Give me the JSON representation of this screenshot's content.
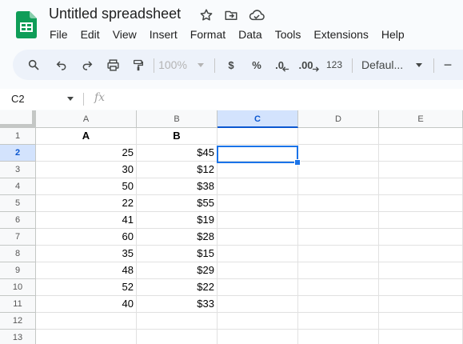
{
  "app": {
    "title": "Untitled spreadsheet",
    "accent": "#0f9d58",
    "menu": [
      "File",
      "Edit",
      "View",
      "Insert",
      "Format",
      "Data",
      "Tools",
      "Extensions",
      "Help"
    ]
  },
  "toolbar": {
    "zoom": "100%",
    "currency": "$",
    "percent": "%",
    "decrease_decimal": ".0",
    "increase_decimal": ".00",
    "more_formats": "123",
    "font": "Defaul...",
    "font_size_minus": "−",
    "icons": [
      "search-icon",
      "undo-icon",
      "redo-icon",
      "print-icon",
      "paint-format-icon"
    ]
  },
  "formula_bar": {
    "cell_ref": "C2",
    "fx": "fx",
    "value": ""
  },
  "grid": {
    "columns": [
      "A",
      "B",
      "C",
      "D",
      "E"
    ],
    "selected_column": "C",
    "selected_row": 2,
    "rows": [
      {
        "n": "1",
        "a": "A",
        "b": "B"
      },
      {
        "n": "2",
        "a": "25",
        "b": "$45"
      },
      {
        "n": "3",
        "a": "30",
        "b": "$12"
      },
      {
        "n": "4",
        "a": "50",
        "b": "$38"
      },
      {
        "n": "5",
        "a": "22",
        "b": "$55"
      },
      {
        "n": "6",
        "a": "41",
        "b": "$19"
      },
      {
        "n": "7",
        "a": "60",
        "b": "$28"
      },
      {
        "n": "8",
        "a": "35",
        "b": "$15"
      },
      {
        "n": "9",
        "a": "48",
        "b": "$29"
      },
      {
        "n": "10",
        "a": "52",
        "b": "$22"
      },
      {
        "n": "11",
        "a": "40",
        "b": "$33"
      },
      {
        "n": "12",
        "a": "",
        "b": ""
      },
      {
        "n": "13",
        "a": "",
        "b": ""
      }
    ]
  }
}
